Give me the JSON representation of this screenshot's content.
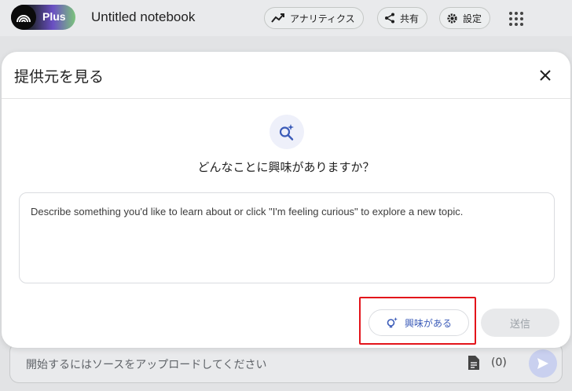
{
  "header": {
    "logo_text": "Plus",
    "notebook_title": "Untitled notebook",
    "analytics_label": "アナリティクス",
    "share_label": "共有",
    "settings_label": "設定"
  },
  "composer": {
    "placeholder": "開始するにはソースをアップロードしてください",
    "source_count": "(0)"
  },
  "modal": {
    "title": "提供元を見る",
    "question": "どんなことに興味がありますか？",
    "topic_placeholder": "Describe something you'd like to learn about or click \"I'm feeling curious\" to explore a new topic.",
    "curious_label": "興味がある",
    "submit_label": "送信"
  },
  "colors": {
    "accent": "#3b5bb8",
    "highlight": "#e3141b",
    "send_bg": "#c9d0ef"
  }
}
